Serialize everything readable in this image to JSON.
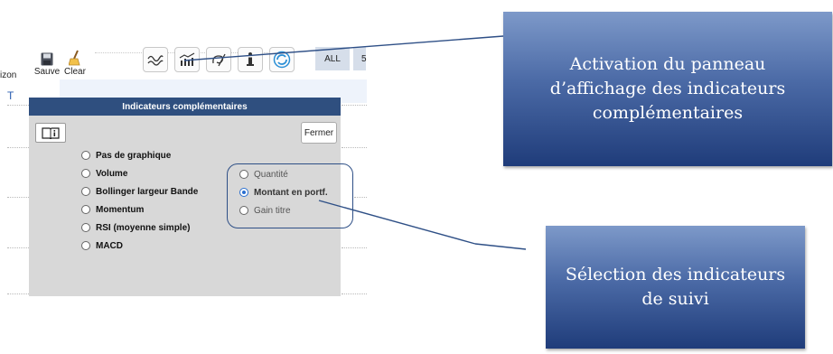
{
  "toolbar": {
    "partial_label": "izon",
    "save_label": "Sauve",
    "clear_label": "Clear",
    "range_all": "ALL",
    "range_partial": "5",
    "left_mark": "T"
  },
  "panel": {
    "title": "Indicateurs complémentaires",
    "close_label": "Fermer",
    "options": [
      {
        "label": "Pas de graphique",
        "selected": false
      },
      {
        "label": "Volume",
        "selected": false
      },
      {
        "label": "Bollinger largeur Bande",
        "selected": false
      },
      {
        "label": "Momentum",
        "selected": false
      },
      {
        "label": "RSI (moyenne simple)",
        "selected": false
      },
      {
        "label": "MACD",
        "selected": false
      }
    ],
    "tracking_options": [
      {
        "label": "Quantité",
        "selected": false
      },
      {
        "label": "Montant en portf.",
        "selected": true
      },
      {
        "label": "Gain titre",
        "selected": false
      }
    ]
  },
  "callouts": {
    "panel_activation": "Activation du panneau d’affichage des indicateurs complémentaires",
    "tracking_selection": "Sélection des indicateurs de suivi"
  },
  "colors": {
    "panel_title_bg": "#2f4f7f",
    "panel_bg": "#d8d8d8",
    "callout_top": "#7d99c9",
    "callout_bottom": "#1f3c7a",
    "radio_selected": "#2a6fd0"
  },
  "icons": [
    "save-icon",
    "clear-broom-icon",
    "wave-chart-icon",
    "bar-chart-icon",
    "indicator-pen-icon",
    "info-icon",
    "refresh-icon",
    "book-info-icon"
  ]
}
